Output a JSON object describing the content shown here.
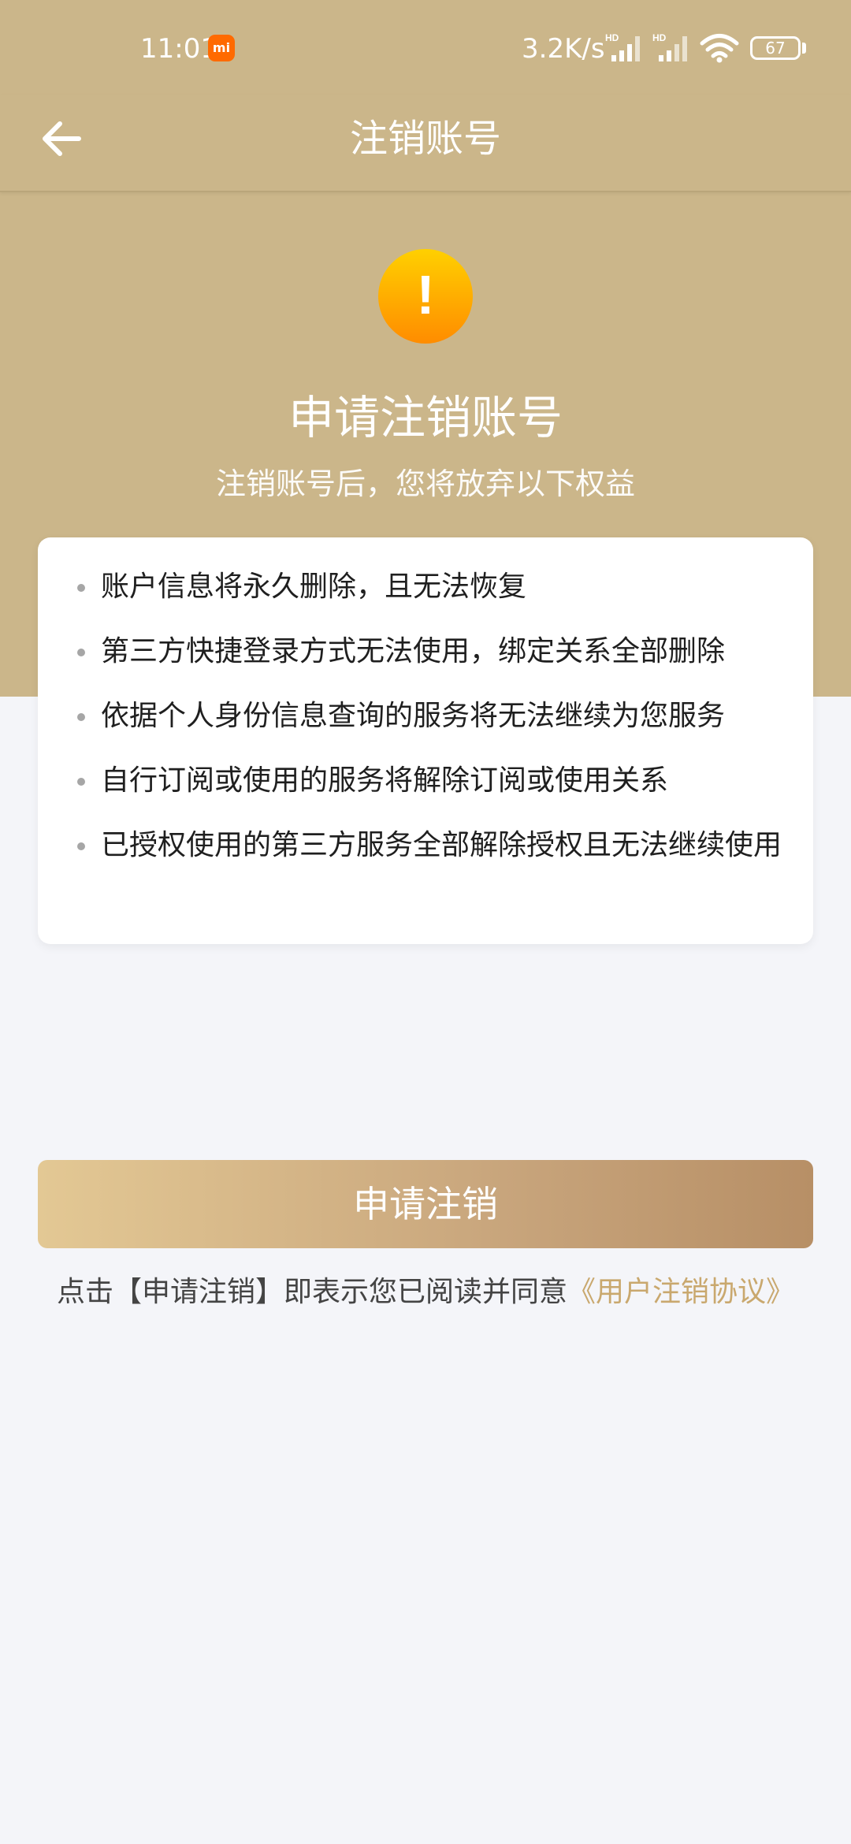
{
  "status_bar": {
    "time": "11:01",
    "mi_badge": "mi",
    "network_speed": "3.2K/s",
    "signal_label_1": "HD",
    "signal_label_2": "HD",
    "battery": "67"
  },
  "header": {
    "title": "注销账号"
  },
  "hero": {
    "icon_glyph": "!",
    "title": "申请注销账号",
    "subtitle": "注销账号后，您将放弃以下权益"
  },
  "benefits": {
    "items": [
      "账户信息将永久删除，且无法恢复",
      "第三方快捷登录方式无法使用，绑定关系全部删除",
      "依据个人身份信息查询的服务将无法继续为您服务",
      "自行订阅或使用的服务将解除订阅或使用关系",
      "已授权使用的第三方服务全部解除授权且无法继续使用"
    ]
  },
  "actions": {
    "apply_label": "申请注销"
  },
  "agreement": {
    "prefix": "点击【申请注销】即表示您已阅读并同意",
    "link": "《用户注销协议》"
  },
  "colors": {
    "header_background": "#cbb68a",
    "page_background": "#f4f5f9",
    "warning_orange": "#ff9800",
    "link_gold": "#c9a86e",
    "button_gradient_start": "#e3c894",
    "button_gradient_end": "#b78f66"
  },
  "icons": {
    "back": "arrow-left-icon",
    "warning": "exclamation-circle-icon",
    "signal": "cellular-signal-icon",
    "wifi": "wifi-icon",
    "battery": "battery-icon"
  }
}
